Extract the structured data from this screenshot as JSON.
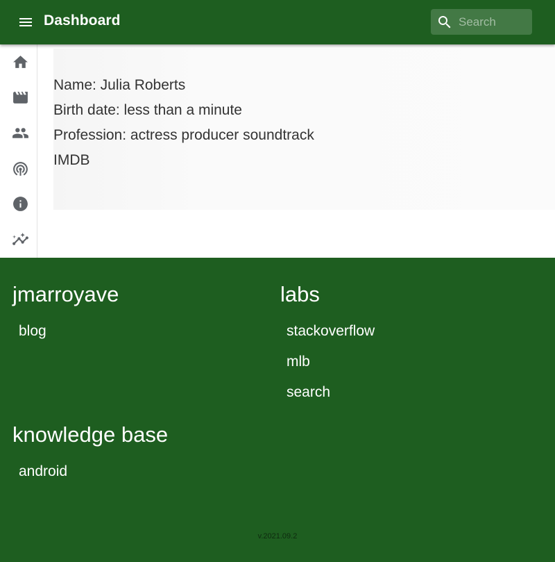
{
  "header": {
    "title": "Dashboard",
    "menu_icon": "menu-icon",
    "search": {
      "placeholder": "Search",
      "value": "",
      "icon": "search-icon"
    }
  },
  "sidebar": {
    "items": [
      {
        "id": "home",
        "icon": "home-icon"
      },
      {
        "id": "movies",
        "icon": "movie-icon"
      },
      {
        "id": "people",
        "icon": "people-icon"
      },
      {
        "id": "podcasts",
        "icon": "podcast-icon"
      },
      {
        "id": "info",
        "icon": "info-icon"
      },
      {
        "id": "analytics",
        "icon": "insights-icon"
      }
    ]
  },
  "person": {
    "name": "Name: Julia Roberts",
    "birth_date": "Birth date: less than a minute",
    "profession": "Profession: actress producer soundtrack",
    "imdb_link": "IMDB"
  },
  "footer": {
    "sections": [
      {
        "heading": "jmarroyave",
        "links": [
          "blog"
        ]
      },
      {
        "heading": "labs",
        "links": [
          "stackoverflow",
          "mlb",
          "search"
        ]
      },
      {
        "heading": "knowledge base",
        "links": [
          "android"
        ]
      }
    ],
    "version": "v.2021.09.2"
  },
  "colors": {
    "primary": "#1e5e20",
    "on_primary": "#ffffff",
    "sidebar_icon": "#5f6368",
    "text": "#333333"
  }
}
